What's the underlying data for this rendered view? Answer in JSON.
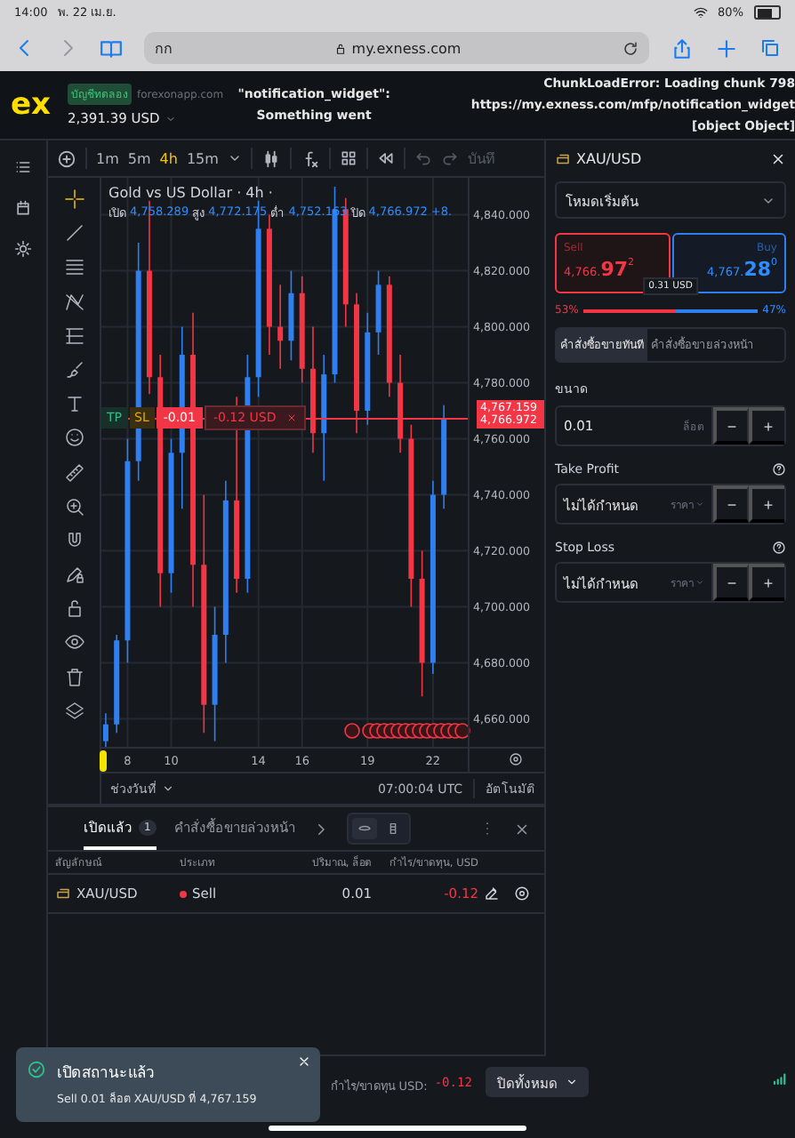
{
  "browser": {
    "time": "14:00",
    "date": "พ. 22 เม.ย.",
    "battery": "80%",
    "tab_text": "กก",
    "url": "my.exness.com"
  },
  "header": {
    "logo": "ex",
    "account_type": "บัญชีทดลอง",
    "server": "forexonapp.com",
    "balance": "2,391.39 USD",
    "widget_error": [
      "\"notification_widget\":",
      "Something went"
    ],
    "chunk_error": [
      "ChunkLoadError: Loading chunk 798",
      "https://my.exness.com/mfp/notification_widget",
      "[object Object]"
    ]
  },
  "chart": {
    "timeframes": [
      {
        "label": "1m",
        "selected": false
      },
      {
        "label": "5m",
        "selected": false
      },
      {
        "label": "4h",
        "selected": true
      },
      {
        "label": "15m",
        "selected": false
      }
    ],
    "save_label": "บันทึ",
    "title": "Gold vs US Dollar · 4h ·",
    "ohlc": [
      {
        "label": "เปิด",
        "value": "4,758.289"
      },
      {
        "label": "สูง",
        "value": "4,772.175"
      },
      {
        "label": "ต่ำ",
        "value": "4,752.163"
      },
      {
        "label": "ปิด",
        "value": "4,766.972"
      }
    ],
    "change": "+8.",
    "chart_data": {
      "type": "candlestick",
      "x": [
        7,
        7.5,
        8,
        8.5,
        9,
        9.5,
        10,
        10.5,
        11,
        11.5,
        12,
        12.5,
        13,
        13.5,
        14,
        14.5,
        15,
        15.5,
        16,
        16.5,
        17,
        17.5,
        18,
        18.5,
        19,
        19.5,
        20,
        20.5,
        21,
        21.5,
        22,
        22.5
      ],
      "xlim": [
        6.8,
        27.1
      ],
      "ylim": [
        4641.1,
        4853.2
      ],
      "grid": true,
      "ohlc": [
        [
          4652,
          4662,
          4650,
          4658
        ],
        [
          4658,
          4690,
          4655,
          4688
        ],
        [
          4688,
          4760,
          4680,
          4752
        ],
        [
          4752,
          4830,
          4745,
          4820
        ],
        [
          4820,
          4845,
          4776,
          4782
        ],
        [
          4782,
          4790,
          4700,
          4712
        ],
        [
          4712,
          4760,
          4705,
          4755
        ],
        [
          4755,
          4800,
          4735,
          4790
        ],
        [
          4790,
          4805,
          4700,
          4715
        ],
        [
          4715,
          4740,
          4655,
          4665
        ],
        [
          4665,
          4700,
          4652,
          4690
        ],
        [
          4690,
          4745,
          4680,
          4738
        ],
        [
          4738,
          4775,
          4705,
          4710
        ],
        [
          4710,
          4790,
          4705,
          4782
        ],
        [
          4782,
          4845,
          4775,
          4835
        ],
        [
          4835,
          4840,
          4790,
          4800
        ],
        [
          4800,
          4815,
          4785,
          4795
        ],
        [
          4795,
          4820,
          4788,
          4812
        ],
        [
          4812,
          4818,
          4780,
          4785
        ],
        [
          4785,
          4800,
          4755,
          4762
        ],
        [
          4762,
          4790,
          4745,
          4783
        ],
        [
          4783,
          4850,
          4780,
          4842
        ],
        [
          4842,
          4846,
          4800,
          4808
        ],
        [
          4808,
          4812,
          4762,
          4770
        ],
        [
          4770,
          4805,
          4765,
          4798
        ],
        [
          4798,
          4820,
          4790,
          4815
        ],
        [
          4815,
          4818,
          4775,
          4780
        ],
        [
          4780,
          4790,
          4755,
          4760
        ],
        [
          4760,
          4765,
          4700,
          4710
        ],
        [
          4710,
          4720,
          4668,
          4680
        ],
        [
          4680,
          4745,
          4676,
          4740
        ],
        [
          4740,
          4772,
          4735,
          4767
        ]
      ],
      "yticks": [
        {
          "value": 4840,
          "label": "4,840.000"
        },
        {
          "value": 4820,
          "label": "4,820.000"
        },
        {
          "value": 4800,
          "label": "4,800.000"
        },
        {
          "value": 4780,
          "label": "4,780.000"
        },
        {
          "value": 4760,
          "label": "4,760.000"
        },
        {
          "value": 4740,
          "label": "4,740.000"
        },
        {
          "value": 4720,
          "label": "4,720.000"
        },
        {
          "value": 4700,
          "label": "4,700.000"
        },
        {
          "value": 4680,
          "label": "4,680.000"
        },
        {
          "value": 4660,
          "label": "4,660.000"
        }
      ],
      "xticks": [
        8,
        10,
        14,
        16,
        19,
        22
      ]
    },
    "bid_label": "4,767.159",
    "ask_label": "4,766.972",
    "position": {
      "tp": "TP",
      "sl": "SL",
      "volume": "-0.01",
      "pnl": "-0.12 USD"
    },
    "date_range": "ช่วงวันที่",
    "clock": "07:00:04 UTC",
    "auto": "อัตโนมัติ"
  },
  "order_panel": {
    "symbol": "XAU/USD",
    "mode": "โหมดเริ่มต้น",
    "sell": {
      "label": "Sell",
      "price_main": "4,766.",
      "price_big": "97",
      "price_sup": "2"
    },
    "buy": {
      "label": "Buy",
      "price_main": "4,767.",
      "price_big": "28",
      "price_sup": "0"
    },
    "spread": "0.31 USD",
    "sell_pct": "53%",
    "buy_pct": "47%",
    "level": 0.53,
    "order_tabs": [
      {
        "label": "คำสั่งซื้อขายทันที",
        "selected": true
      },
      {
        "label": "คำสั่งซื้อขายล่วงหน้า",
        "selected": false
      }
    ],
    "volume_label": "ขนาด",
    "volume": "0.01",
    "volume_unit": "ล็อต",
    "minus": "−",
    "plus": "+",
    "fields": [
      {
        "label": "Take Profit",
        "value": "ไม่ได้กำหนด",
        "unit": "ราคา"
      },
      {
        "label": "Stop Loss",
        "value": "ไม่ได้กำหนด",
        "unit": "ราคา"
      }
    ]
  },
  "positions": {
    "tabs": [
      {
        "label": "เปิดแล้ว",
        "count": "1",
        "selected": true
      },
      {
        "label": "คำสั่งซื้อขายล่วงหน้า",
        "selected": false
      }
    ],
    "view_toggle": [
      {
        "selected": true
      },
      {
        "selected": false
      }
    ],
    "columns": [
      "สัญลักษณ์",
      "ประเภท",
      "ปริมาณ, ล็อต",
      "กำไร/ขาดทุน, USD"
    ],
    "rows": [
      {
        "symbol": "XAU/USD",
        "type": "Sell",
        "color": "#f23645",
        "volume": "0.01",
        "pnl": "-0.12"
      }
    ]
  },
  "footer": {
    "pnl_label": "กำไร/ขาดทุน USD:",
    "pnl": "-0.12",
    "close_all": "ปิดทั้งหมด"
  },
  "toast": {
    "title": "เปิดสถานะแล้ว",
    "message": "Sell 0.01 ล็อต XAU/USD ที่ 4,767.159"
  }
}
